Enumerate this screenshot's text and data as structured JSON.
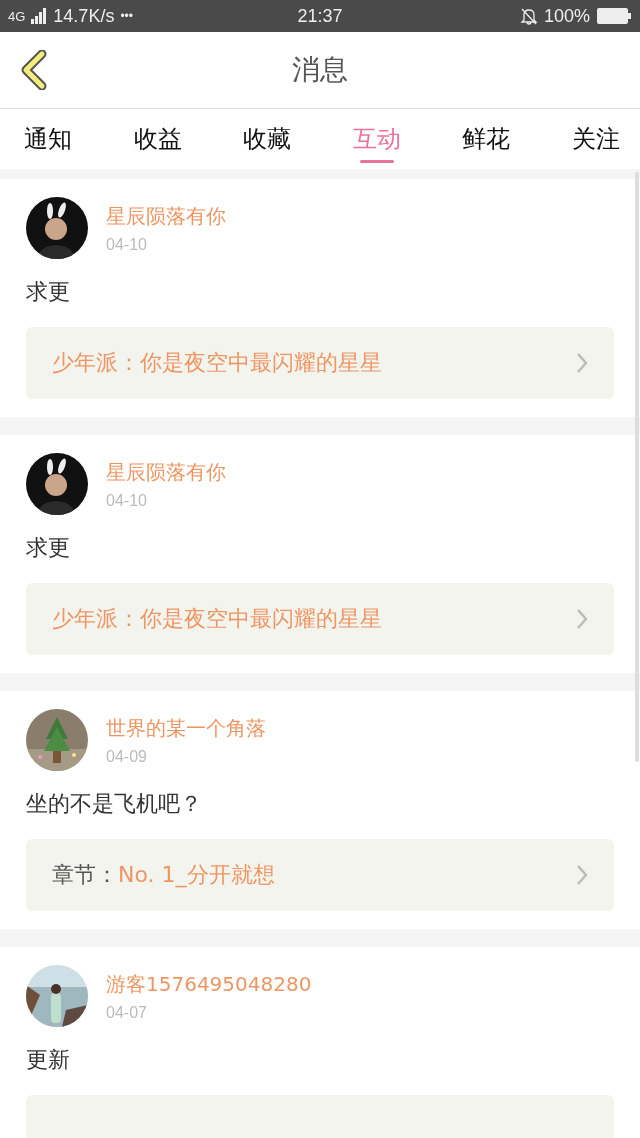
{
  "status_bar": {
    "network": "4G",
    "speed": "14.7K/s",
    "more": "•••",
    "time": "21:37",
    "battery": "100%"
  },
  "header": {
    "title": "消息"
  },
  "tabs": [
    {
      "label": "通知",
      "selected": false
    },
    {
      "label": "收益",
      "selected": false
    },
    {
      "label": "收藏",
      "selected": false
    },
    {
      "label": "互动",
      "selected": true
    },
    {
      "label": "鲜花",
      "selected": false
    },
    {
      "label": "关注",
      "selected": false
    }
  ],
  "messages": [
    {
      "user": "星辰陨落有你",
      "date": "04-10",
      "text": "求更",
      "link": {
        "kind": "work",
        "title": "少年派：你是夜空中最闪耀的星星"
      }
    },
    {
      "user": "星辰陨落有你",
      "date": "04-10",
      "text": "求更",
      "link": {
        "kind": "work",
        "title": "少年派：你是夜空中最闪耀的星星"
      }
    },
    {
      "user": "世界的某一个角落",
      "date": "04-09",
      "text": "坐的不是飞机吧？",
      "link": {
        "kind": "chapter",
        "label": "章节：",
        "title": "No. 1_分开就想"
      }
    },
    {
      "user": "游客1576495048280",
      "date": "04-07",
      "text": "更新",
      "link": {
        "kind": "cut"
      }
    }
  ]
}
